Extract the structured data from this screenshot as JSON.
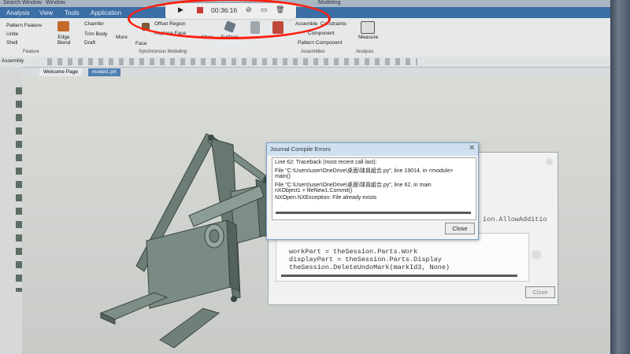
{
  "window": {
    "title_fragment": "Search Window",
    "dropdown_label": "Window",
    "right_title": "Modeling"
  },
  "menu": {
    "items": [
      "Analysis",
      "View",
      "Tools",
      "Application"
    ]
  },
  "recording": {
    "time": "00:36:16",
    "icons": [
      "play-icon",
      "stop-icon",
      "mic-off-icon",
      "screen-icon",
      "trash-icon"
    ]
  },
  "ribbon": {
    "feature": [
      "Pattern Feature",
      "Unite",
      "Shell"
    ],
    "edge_blend": "Edge Blend",
    "chamfer": "Chamfer",
    "trim_body": "Trim Body",
    "draft": "Draft",
    "more1": "More",
    "face": "Face",
    "offset_region": "Offset Region",
    "replace_face": "Replace Face",
    "more2": "More",
    "surface": "Surface",
    "assemble": "Assemble",
    "assemble_constraints": "Constraints",
    "component": "Component",
    "pattern_component": "Pattern Component",
    "measure": "Measure",
    "groups": {
      "feature": "Feature",
      "synchronous": "Synchronous Modeling",
      "assemblies": "Assemblies",
      "analysis": "Analysis"
    }
  },
  "toolbar2": {
    "label": "Assembly"
  },
  "tabs": [
    {
      "label": "Welcome Page"
    },
    {
      "label": "model1.prt"
    }
  ],
  "error_dialog": {
    "title": "Journal Compile Errors",
    "lines": [
      "Line 62: Traceback (most recent call last):",
      "  File \"C:\\Users\\user\\OneDrive\\桌面\\球員組合.py\", line 19014, in <module>",
      "    main()",
      "  File \"C:\\Users\\user\\OneDrive\\桌面\\球員組合.py\", line 62, in main",
      "    nXObject1 = fileNew1.Commit()",
      "NXOpen.NXException: File already exists"
    ],
    "close_label": "Close"
  },
  "back_dialog": {
    "code_lines": [
      "workPart = theSession.Parts.Work",
      "displayPart = theSession.Parts.Display",
      "theSession.DeleteUndoMark(markId3, None)"
    ],
    "side_text": "ion.AllowAdditio",
    "close_label": "Close"
  }
}
